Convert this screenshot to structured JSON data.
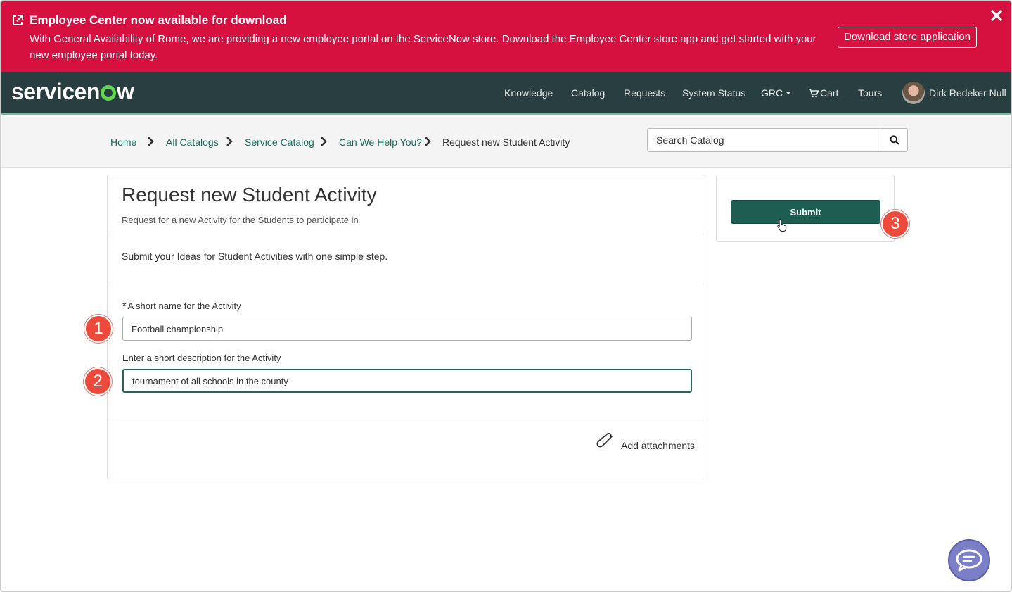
{
  "banner": {
    "title": "Employee Center now available for download",
    "text": "With General Availability of Rome, we are providing a new employee portal on the ServiceNow store. Download the Employee Center store app and get started with your new employee portal today.",
    "download_label": "Download store application",
    "bg_color": "#d6103f"
  },
  "navbar": {
    "logo_prefix": "servicen",
    "logo_suffix": "w",
    "items": [
      "Knowledge",
      "Catalog",
      "Requests",
      "System Status",
      "GRC",
      "Cart",
      "Tours"
    ],
    "user_name": "Dirk Redeker Null"
  },
  "breadcrumb": {
    "items": [
      "Home",
      "All Catalogs",
      "Service Catalog",
      "Can We Help You?"
    ],
    "current": "Request new Student Activity"
  },
  "search": {
    "placeholder": "Search Catalog"
  },
  "form": {
    "title": "Request new Student Activity",
    "subtitle": "Request for a new Activity for the Students to participate in",
    "intro": "Submit your Ideas for Student Activities with one simple step.",
    "required_mark": "*",
    "field1_label": "A short name for the Activity",
    "field1_value": "Football championship",
    "field2_label": "Enter a short description for the Activity",
    "field2_value": "tournament of all schools in the county",
    "attachments_label": "Add attachments"
  },
  "side": {
    "submit_label": "Submit"
  },
  "markers": [
    "1",
    "2",
    "3"
  ],
  "colors": {
    "accent": "#1e5e52",
    "nav_bg": "#293e40",
    "marker": "#ee4a3c"
  }
}
